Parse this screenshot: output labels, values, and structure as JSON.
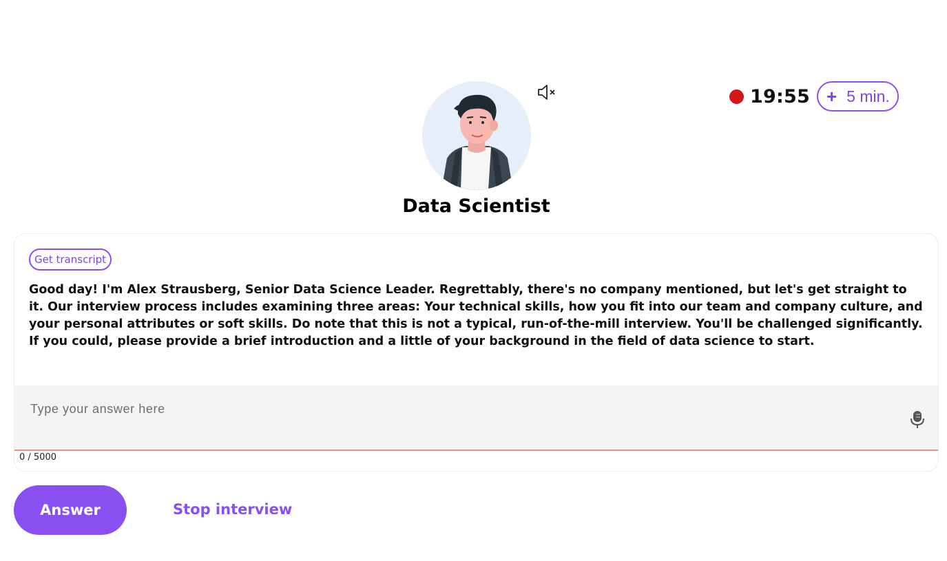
{
  "header": {
    "interviewer_title": "Data Scientist",
    "mute_icon": "speaker-muted-icon",
    "avatar_icon": "interviewer-avatar"
  },
  "timer": {
    "time": "19:55",
    "recording_indicator_color": "#d6151b",
    "add_time_icon": "plus-icon",
    "add_time_label": "5 min."
  },
  "card": {
    "transcript_button": "Get transcript",
    "question": "Good day! I'm Alex Strausberg, Senior Data Science Leader. Regrettably, there's no company mentioned, but let's get straight to it. Our interview process includes examining three areas: Your technical skills, how you fit into our team and company culture, and your personal attributes or soft skills. Do note that this is not a typical, run-of-the-mill interview. You'll be challenged significantly. If you could, please provide a brief introduction and a little of your background in the field of data science to start.",
    "answer_value": "",
    "answer_placeholder": "Type your answer here",
    "mic_icon": "microphone-icon",
    "char_count": "0 / 5000"
  },
  "actions": {
    "answer_button": "Answer",
    "stop_button": "Stop interview"
  },
  "colors": {
    "accent": "#8a4ff0",
    "input_underline": "#ef8e87",
    "input_background": "#f4f4f4"
  }
}
